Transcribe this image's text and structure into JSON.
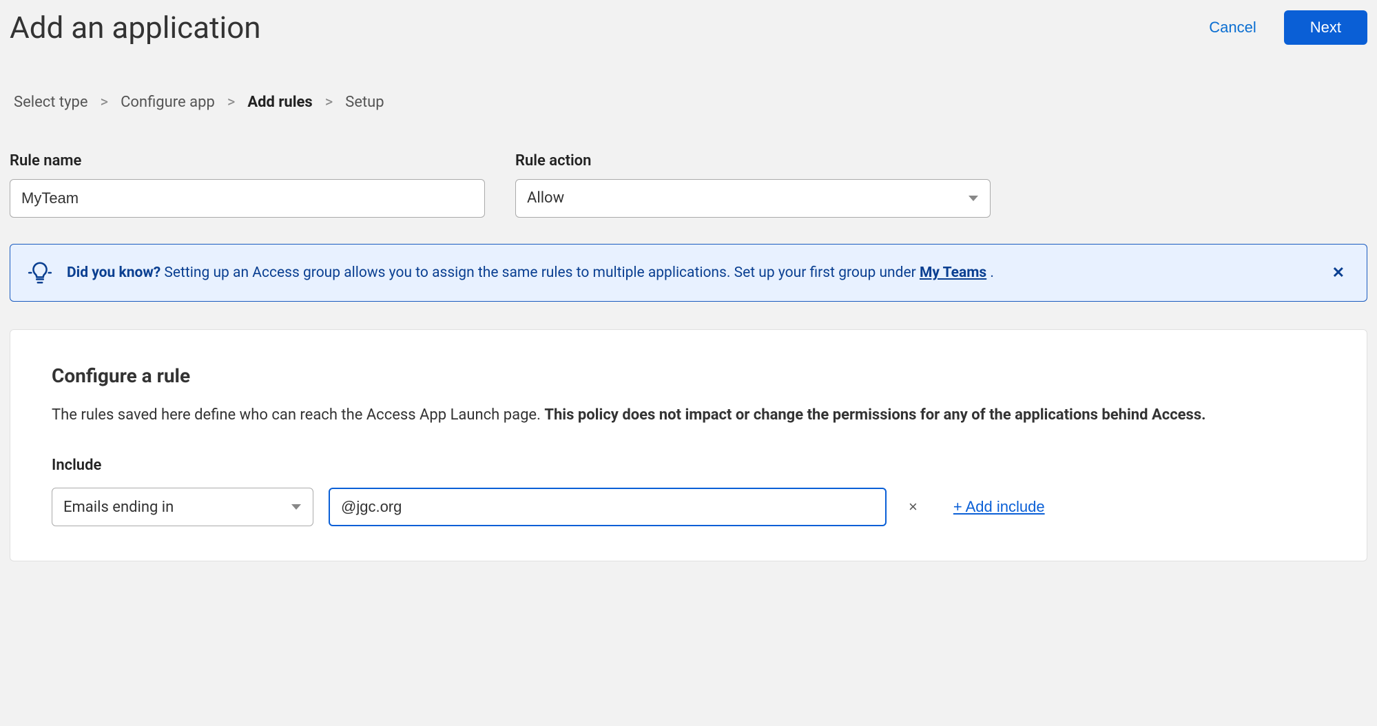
{
  "header": {
    "title": "Add an application",
    "cancel_label": "Cancel",
    "next_label": "Next"
  },
  "breadcrumb": {
    "items": [
      {
        "label": "Select type",
        "active": false
      },
      {
        "label": "Configure app",
        "active": false
      },
      {
        "label": "Add rules",
        "active": true
      },
      {
        "label": "Setup",
        "active": false
      }
    ],
    "separator": ">"
  },
  "form": {
    "rule_name_label": "Rule name",
    "rule_name_value": "MyTeam",
    "rule_action_label": "Rule action",
    "rule_action_value": "Allow"
  },
  "banner": {
    "bold_prefix": "Did you know?",
    "text": " Setting up an Access group allows you to assign the same rules to multiple applications. Set up your first group under ",
    "link_label": "My Teams",
    "suffix": " ."
  },
  "panel": {
    "title": "Configure a rule",
    "desc_plain": "The rules saved here define who can reach the Access App Launch page. ",
    "desc_bold": "This policy does not impact or change the permissions for any of the applications behind Access.",
    "include_label": "Include",
    "include_type": "Emails ending in",
    "include_value": "@jgc.org",
    "add_include_label": "+ Add include"
  }
}
